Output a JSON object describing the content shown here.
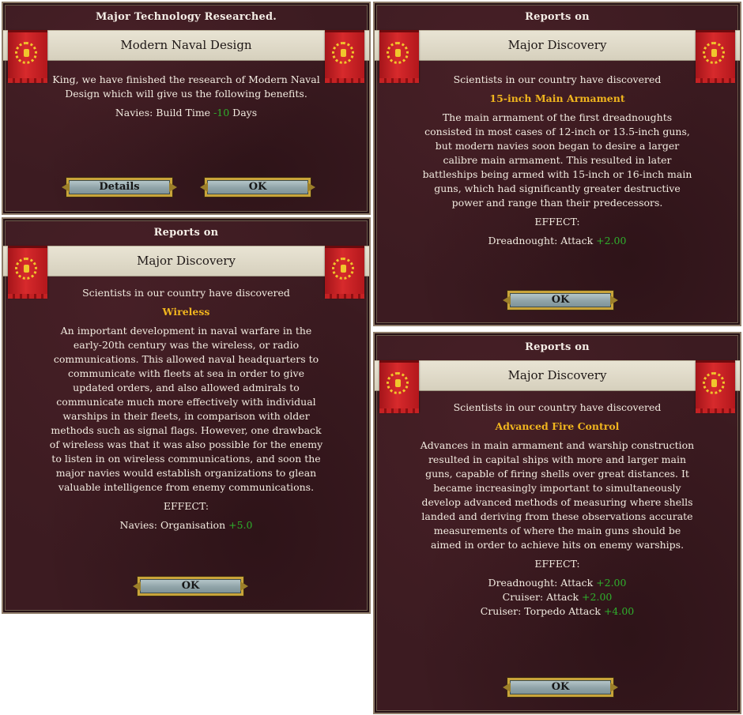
{
  "panel_tech": {
    "top": "Major Technology Researched.",
    "title": "Modern Naval Design",
    "message": "King, we have finished the research of Modern Naval Design which will give us the following benefits.",
    "effect_label": "Navies: Build Time ",
    "effect_value": "-10",
    "effect_suffix": " Days",
    "details_button": "Details",
    "ok_button": "OK"
  },
  "panel_armament": {
    "top": "Reports on",
    "title": "Major Discovery",
    "intro": "Scientists in our country have discovered",
    "tech_name": "15-inch Main Armament",
    "description": "The main armament of the first dreadnoughts consisted in most cases of 12-inch or 13.5-inch guns, but modern navies soon began to desire a larger calibre main armament. This resulted in later battleships being armed with 15-inch or 16-inch main guns, which had significantly greater destructive power and range than their predecessors.",
    "effect_header": "EFFECT:",
    "effects": [
      {
        "label": "Dreadnought: Attack ",
        "value": "+2.00"
      }
    ],
    "ok_button": "OK"
  },
  "panel_wireless": {
    "top": "Reports on",
    "title": "Major Discovery",
    "intro": "Scientists in our country have discovered",
    "tech_name": "Wireless",
    "description": "An important development in naval warfare in the early-20th century was the wireless, or radio communications. This allowed naval headquarters to communicate with fleets at sea in order to give updated orders, and also allowed admirals to communicate much more effectively with individual warships in their fleets, in comparison with older methods such as signal flags. However, one drawback of wireless was that it was also possible for the enemy to listen in on wireless communications, and soon the major navies would establish organizations to glean valuable intelligence from enemy communications.",
    "effect_header": "EFFECT:",
    "effects": [
      {
        "label": "Navies: Organisation ",
        "value": "+5.0"
      }
    ],
    "ok_button": "OK"
  },
  "panel_fire_control": {
    "top": "Reports on",
    "title": "Major Discovery",
    "intro": "Scientists in our country have discovered",
    "tech_name": "Advanced Fire Control",
    "description": "Advances in main armament and warship construction resulted in capital ships with more and larger main guns, capable of firing shells over great distances. It became increasingly important to simultaneously develop advanced methods of measuring where shells landed and deriving from these observations accurate measurements of where the main guns should be aimed in order to achieve hits on enemy warships.",
    "effect_header": "EFFECT:",
    "effects": [
      {
        "label": "Dreadnought: Attack ",
        "value": "+2.00"
      },
      {
        "label": "Cruiser: Attack ",
        "value": "+2.00"
      },
      {
        "label": "Cruiser: Torpedo Attack ",
        "value": "+4.00"
      }
    ],
    "ok_button": "OK"
  },
  "colors": {
    "panel_bg": "#3c1b21",
    "tech_name": "#f0b51e",
    "positive_value": "#2fb02c",
    "banner_red": "#d72a2c",
    "band": "#e3dece"
  },
  "icons": [
    "flag-emblem-icon"
  ]
}
